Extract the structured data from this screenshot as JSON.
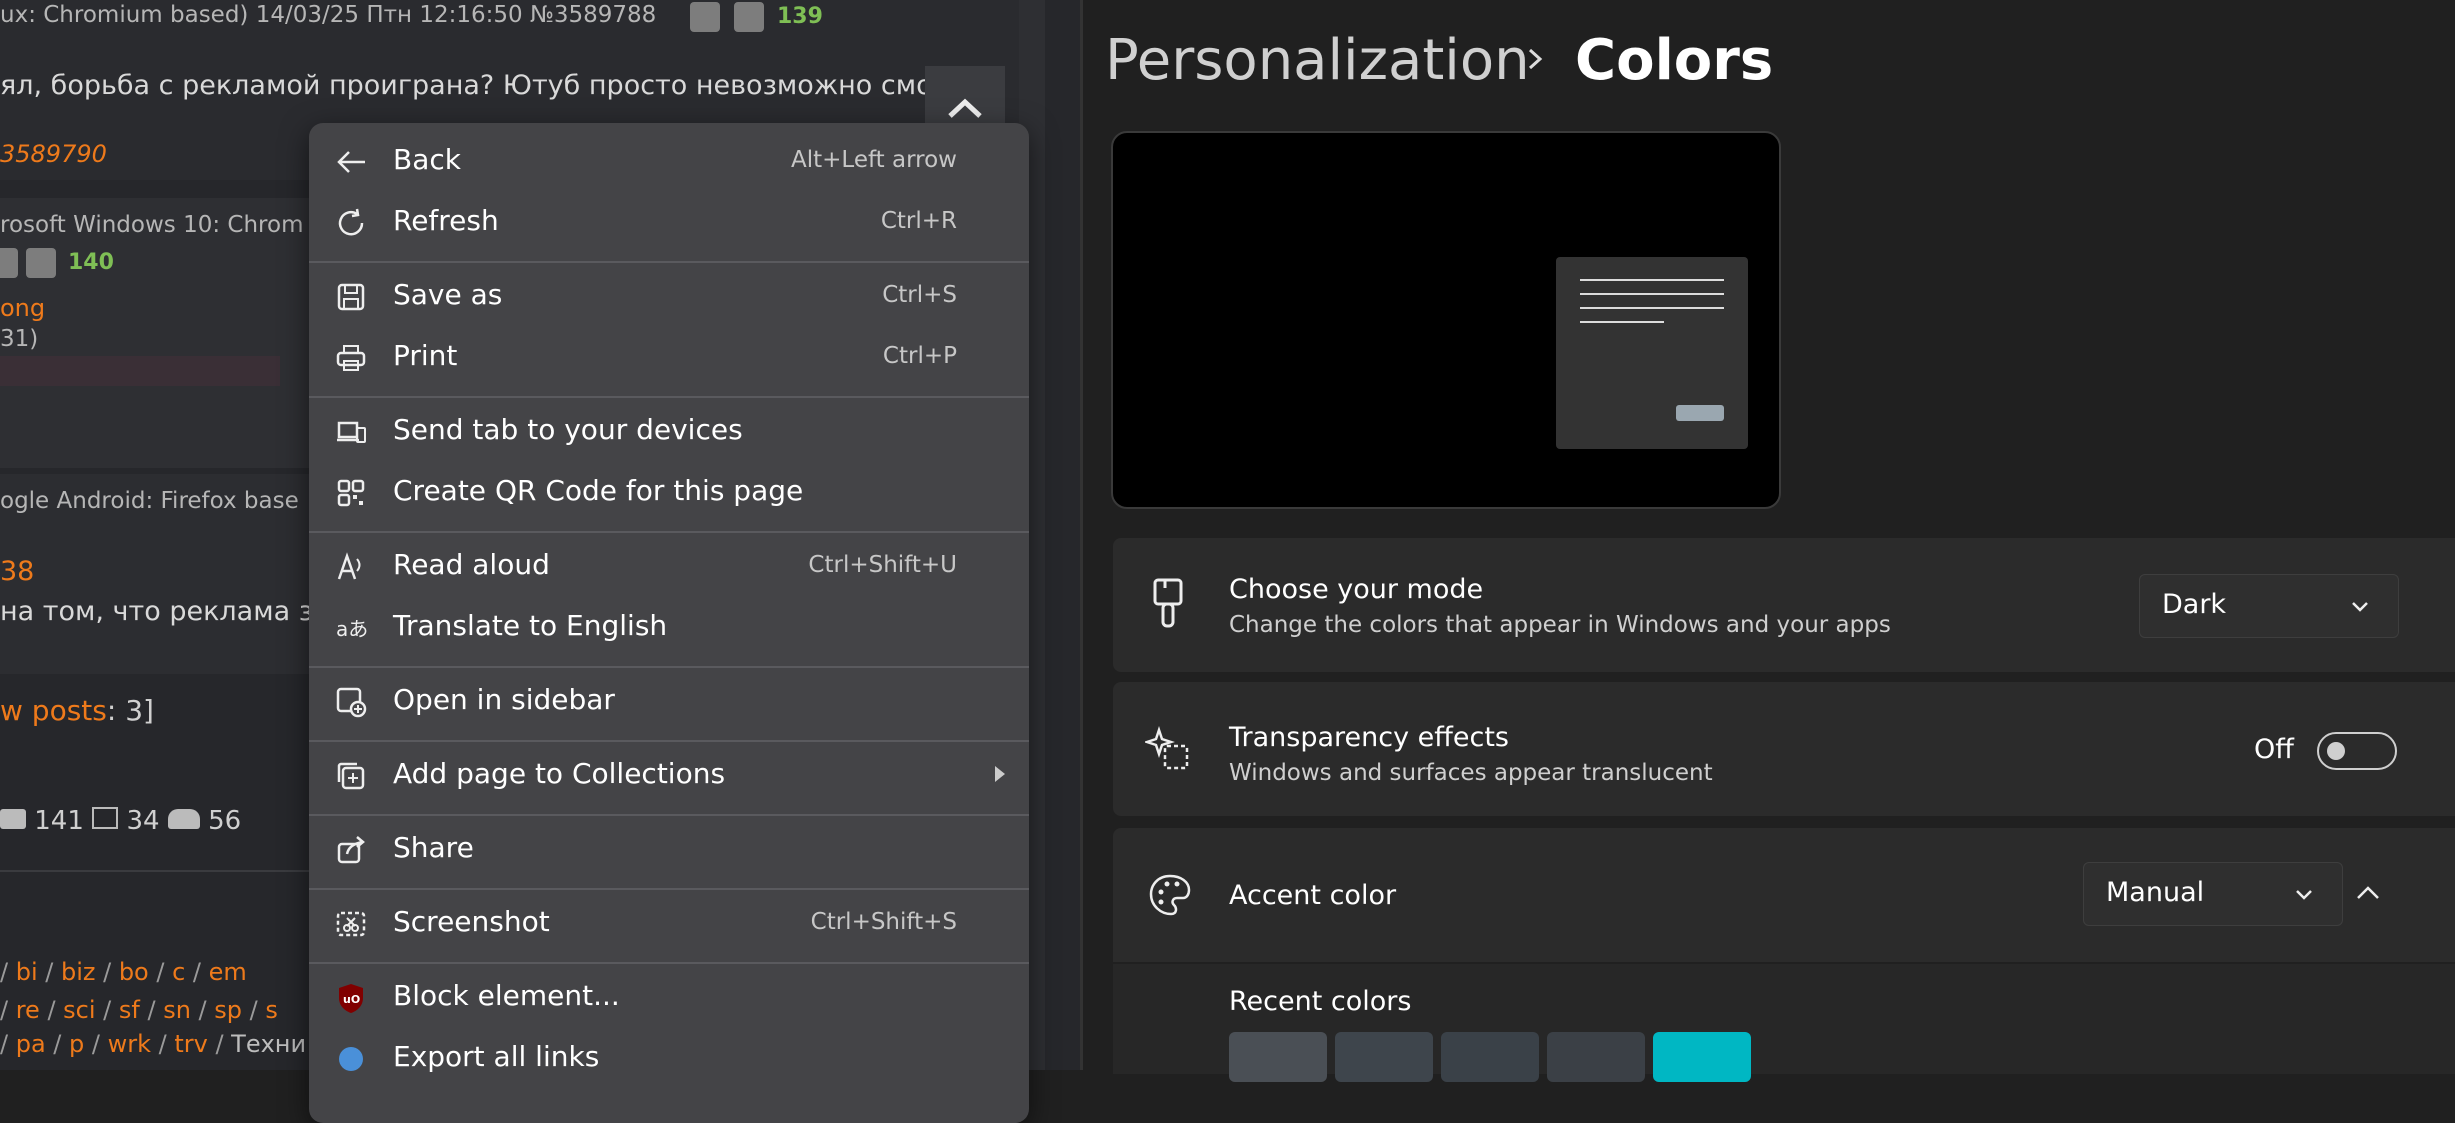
{
  "left": {
    "post1_meta": "ux: Chromium based) 14/03/25 Птн 12:16:50 №3589788",
    "post1_count": "139",
    "post1_text": "ял, борьба с рекламой проиграна? Ютуб просто невозможно смотр",
    "post1_reply": "3589790",
    "post2_meta": "rosoft Windows 10: Chrom",
    "post2_count": "140",
    "post2_name": "ong",
    "post2_sub": "31)",
    "post3_meta": "ogle Android: Firefox base",
    "post3_num": "38",
    "post3_text": " на том, что реклама з",
    "newposts_link": "w posts",
    "newposts_rest": ": 3]",
    "stat_posts": "141",
    "stat_images": "34",
    "stat_users": "56",
    "nav1": [
      "bi",
      "biz",
      "bo",
      "c",
      "em"
    ],
    "nav2": [
      "re",
      "sci",
      "sf",
      "sn",
      "sp",
      "s"
    ],
    "nav3": [
      "pa",
      "p",
      "wrk",
      "trv"
    ],
    "nav3_tail": "Техни"
  },
  "menu": {
    "items": [
      {
        "label": "Back",
        "shortcut": "Alt+Left arrow",
        "icon": "back-arrow-icon"
      },
      {
        "label": "Refresh",
        "shortcut": "Ctrl+R",
        "icon": "refresh-icon"
      },
      {
        "label": "Save as",
        "shortcut": "Ctrl+S",
        "icon": "save-icon"
      },
      {
        "label": "Print",
        "shortcut": "Ctrl+P",
        "icon": "print-icon"
      },
      {
        "label": "Send tab to your devices",
        "shortcut": "",
        "icon": "devices-icon"
      },
      {
        "label": "Create QR Code for this page",
        "shortcut": "",
        "icon": "qr-code-icon"
      },
      {
        "label": "Read aloud",
        "shortcut": "Ctrl+Shift+U",
        "icon": "read-aloud-icon"
      },
      {
        "label": "Translate to English",
        "shortcut": "",
        "icon": "translate-icon"
      },
      {
        "label": "Open in sidebar",
        "shortcut": "",
        "icon": "sidebar-icon"
      },
      {
        "label": "Add page to Collections",
        "shortcut": "",
        "icon": "collections-icon"
      },
      {
        "label": "Share",
        "shortcut": "",
        "icon": "share-icon"
      },
      {
        "label": "Screenshot",
        "shortcut": "Ctrl+Shift+S",
        "icon": "screenshot-icon"
      },
      {
        "label": "Block element...",
        "shortcut": "",
        "icon": "ublock-icon"
      },
      {
        "label": "Export all links",
        "shortcut": "",
        "icon": "export-links-icon"
      }
    ]
  },
  "settings": {
    "breadcrumb_parent": "Personalization",
    "breadcrumb_current": "Colors",
    "mode_title": "Choose your mode",
    "mode_sub": "Change the colors that appear in Windows and your apps",
    "mode_value": "Dark",
    "transparency_title": "Transparency effects",
    "transparency_sub": "Windows and surfaces appear translucent",
    "transparency_state": "Off",
    "accent_title": "Accent color",
    "accent_value": "Manual",
    "recent_colors_label": "Recent colors",
    "recent_colors": [
      "#4a4f55",
      "#3e454c",
      "#3a4148",
      "#3b4046",
      "#00b7c3"
    ]
  }
}
